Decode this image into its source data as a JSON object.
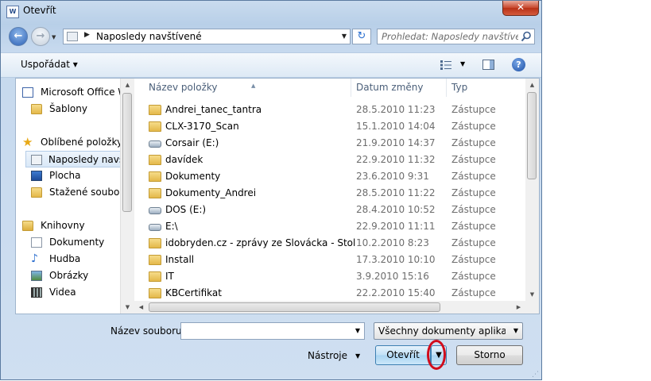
{
  "window": {
    "title": "Otevřít",
    "close_glyph": "✕",
    "app_icon_letter": "W"
  },
  "navigation": {
    "back_glyph": "←",
    "forward_glyph": "→",
    "address_path": "Naposledy navštívené",
    "refresh_glyph": "↻",
    "search_placeholder": "Prohledat: Naposledy navštíve..."
  },
  "toolbar": {
    "organize_label": "Uspořádat ▾",
    "help_glyph": "?"
  },
  "sidebar": {
    "items": [
      {
        "label": "Microsoft Office W",
        "icon": "word-icon"
      },
      {
        "label": "Šablony",
        "icon": "folder-icon"
      },
      {
        "label": "Oblíbené položky",
        "icon": "star-icon"
      },
      {
        "label": "Naposledy navští",
        "icon": "recent-places-icon",
        "selected": true
      },
      {
        "label": "Plocha",
        "icon": "desktop-icon"
      },
      {
        "label": "Stažené soubory",
        "icon": "downloads-icon"
      },
      {
        "label": "Knihovny",
        "icon": "libraries-icon"
      },
      {
        "label": "Dokumenty",
        "icon": "documents-icon"
      },
      {
        "label": "Hudba",
        "icon": "music-icon"
      },
      {
        "label": "Obrázky",
        "icon": "pictures-icon"
      },
      {
        "label": "Videa",
        "icon": "videos-icon"
      }
    ]
  },
  "file_list": {
    "columns": {
      "name": "Název položky",
      "date": "Datum změny",
      "type": "Typ"
    },
    "rows": [
      {
        "name": "Andrei_tanec_tantra",
        "date": "28.5.2010 11:23",
        "type": "Zástupce",
        "icon": "folder"
      },
      {
        "name": "CLX-3170_Scan",
        "date": "15.1.2010 14:04",
        "type": "Zástupce",
        "icon": "folder"
      },
      {
        "name": "Corsair (E:)",
        "date": "21.9.2010 14:37",
        "type": "Zástupce",
        "icon": "drive"
      },
      {
        "name": "davídek",
        "date": "22.9.2010 11:32",
        "type": "Zástupce",
        "icon": "folder"
      },
      {
        "name": "Dokumenty",
        "date": "23.6.2010 9:31",
        "type": "Zástupce",
        "icon": "folder"
      },
      {
        "name": "Dokumenty_Andrei",
        "date": "28.5.2010 11:22",
        "type": "Zástupce",
        "icon": "folder"
      },
      {
        "name": "DOS (E:)",
        "date": "28.4.2010 10:52",
        "type": "Zástupce",
        "icon": "drive"
      },
      {
        "name": "E:\\",
        "date": "22.9.2010 11:11",
        "type": "Zástupce",
        "icon": "drive"
      },
      {
        "name": "idobryden.cz - zprávy ze Slovácka - Stolet...",
        "date": "10.2.2010 8:23",
        "type": "Zástupce",
        "icon": "folder"
      },
      {
        "name": "Install",
        "date": "17.3.2010 10:10",
        "type": "Zástupce",
        "icon": "folder"
      },
      {
        "name": "IT",
        "date": "3.9.2010 15:16",
        "type": "Zástupce",
        "icon": "folder"
      },
      {
        "name": "KBCertifikat",
        "date": "22.2.2010 15:40",
        "type": "Zástupce",
        "icon": "folder"
      }
    ]
  },
  "footer": {
    "filename_label": "Název souboru:",
    "filename_value": "",
    "filter_value": "Všechny dokumenty aplikace W",
    "tools_label": "Nástroje",
    "open_label": "Otevřít",
    "open_split_glyph": "▼",
    "cancel_label": "Storno"
  },
  "colors": {
    "annotation_circle": "#d10c1c",
    "window_chrome": "#c9dbee"
  }
}
